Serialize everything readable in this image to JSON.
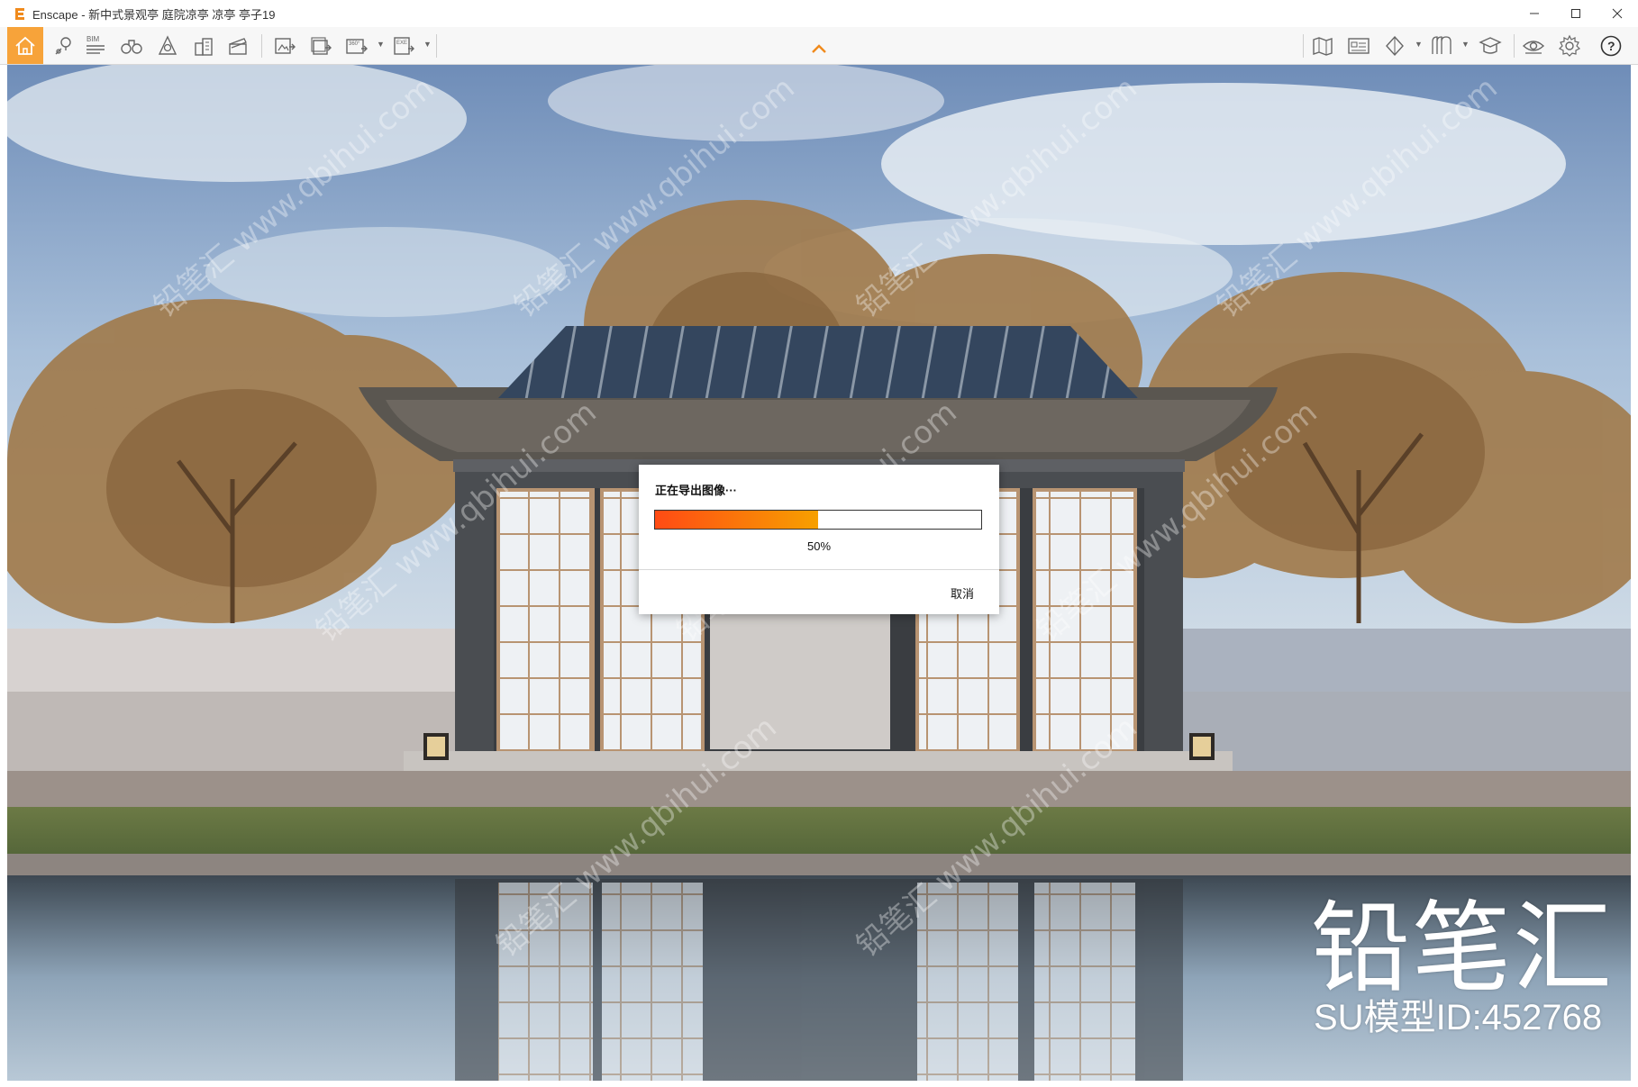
{
  "window": {
    "title": "Enscape - 新中式景观亭 庭院凉亭 凉亭 亭子19",
    "controls": [
      "minimize-icon",
      "maximize-icon",
      "close-icon"
    ]
  },
  "toolbar": {
    "left_icons": [
      "home-icon",
      "location-pin-icon",
      "bim-icon",
      "binoculars-icon",
      "sun-icon",
      "buildings-icon",
      "clapperboard-icon",
      "screenshot-export-icon",
      "batch-export-icon",
      "panorama-360-icon",
      "exe-export-icon"
    ],
    "right_icons": [
      "map-icon",
      "asset-library-icon",
      "view-cube-icon",
      "materials-icon",
      "graduation-cap-icon",
      "eye-icon",
      "gear-icon",
      "help-icon"
    ],
    "bim_label": "BIM",
    "pano_label": "360°",
    "exe_label": "EXE",
    "accent_color": "#f7a33a"
  },
  "dialog": {
    "title": "正在导出图像···",
    "progress": 0.5,
    "progress_label": "50%",
    "cancel_label": "取消",
    "progress_colors": [
      "#ff4b14",
      "#f7a000"
    ]
  },
  "watermark": {
    "brand": "铅笔汇",
    "model_id": "SU模型ID:452768",
    "tiled_text": "铅笔汇 www.qbihui.com"
  }
}
